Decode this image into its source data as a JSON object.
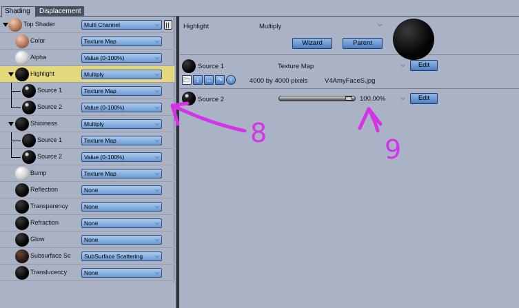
{
  "tabs": [
    {
      "label": "Shading",
      "active": true
    },
    {
      "label": "Displacement",
      "active": false
    }
  ],
  "tree": [
    {
      "key": "top",
      "label": "Top Shader",
      "value": "Multi Channel",
      "sphere": "skin"
    },
    {
      "key": "color",
      "label": "Color",
      "value": "Texture Map",
      "sphere": "skin"
    },
    {
      "key": "alpha",
      "label": "Alpha",
      "value": "Value (0-100%)",
      "sphere": "white"
    },
    {
      "key": "highlight",
      "label": "Highlight",
      "value": "Multiply",
      "sphere": "black",
      "selected": true
    },
    {
      "key": "hl_src1",
      "label": "Source 1",
      "value": "Texture Map",
      "sphere": "tex"
    },
    {
      "key": "hl_src2",
      "label": "Source 2",
      "value": "Value (0-100%)",
      "sphere": "tex"
    },
    {
      "key": "shininess",
      "label": "Shininess",
      "value": "Multiply",
      "sphere": "black"
    },
    {
      "key": "sh_src1",
      "label": "Source 1",
      "value": "Texture Map",
      "sphere": "black"
    },
    {
      "key": "sh_src2",
      "label": "Source 2",
      "value": "Value (0-100%)",
      "sphere": "tex"
    },
    {
      "key": "bump",
      "label": "Bump",
      "value": "Texture Map",
      "sphere": "white"
    },
    {
      "key": "reflection",
      "label": "Reflection",
      "value": "None",
      "sphere": "black"
    },
    {
      "key": "transparency",
      "label": "Transparency",
      "value": "None",
      "sphere": "black"
    },
    {
      "key": "refraction",
      "label": "Refraction",
      "value": "None",
      "sphere": "black"
    },
    {
      "key": "glow",
      "label": "Glow",
      "value": "None",
      "sphere": "black"
    },
    {
      "key": "subsurface",
      "label": "Subsurface Sc",
      "value": "SubSurface Scattering",
      "sphere": "sss"
    },
    {
      "key": "translucency",
      "label": "Translucency",
      "value": "None",
      "sphere": "black"
    }
  ],
  "detail": {
    "channel": "Highlight",
    "mode": "Multiply",
    "wizard_label": "Wizard",
    "parent_label": "Parent",
    "source1": {
      "label": "Source 1",
      "type": "Texture Map",
      "edit_label": "Edit",
      "dimensions": "4000 by 4000 pixels",
      "filename": "V4AmyFaceS.jpg"
    },
    "source2": {
      "label": "Source 2",
      "value": "100.00%",
      "slider_value": 1.0,
      "edit_label": "Edit"
    }
  },
  "annotations": {
    "arrow8": "8",
    "arrow9": "9",
    "color": "#d433e8"
  }
}
